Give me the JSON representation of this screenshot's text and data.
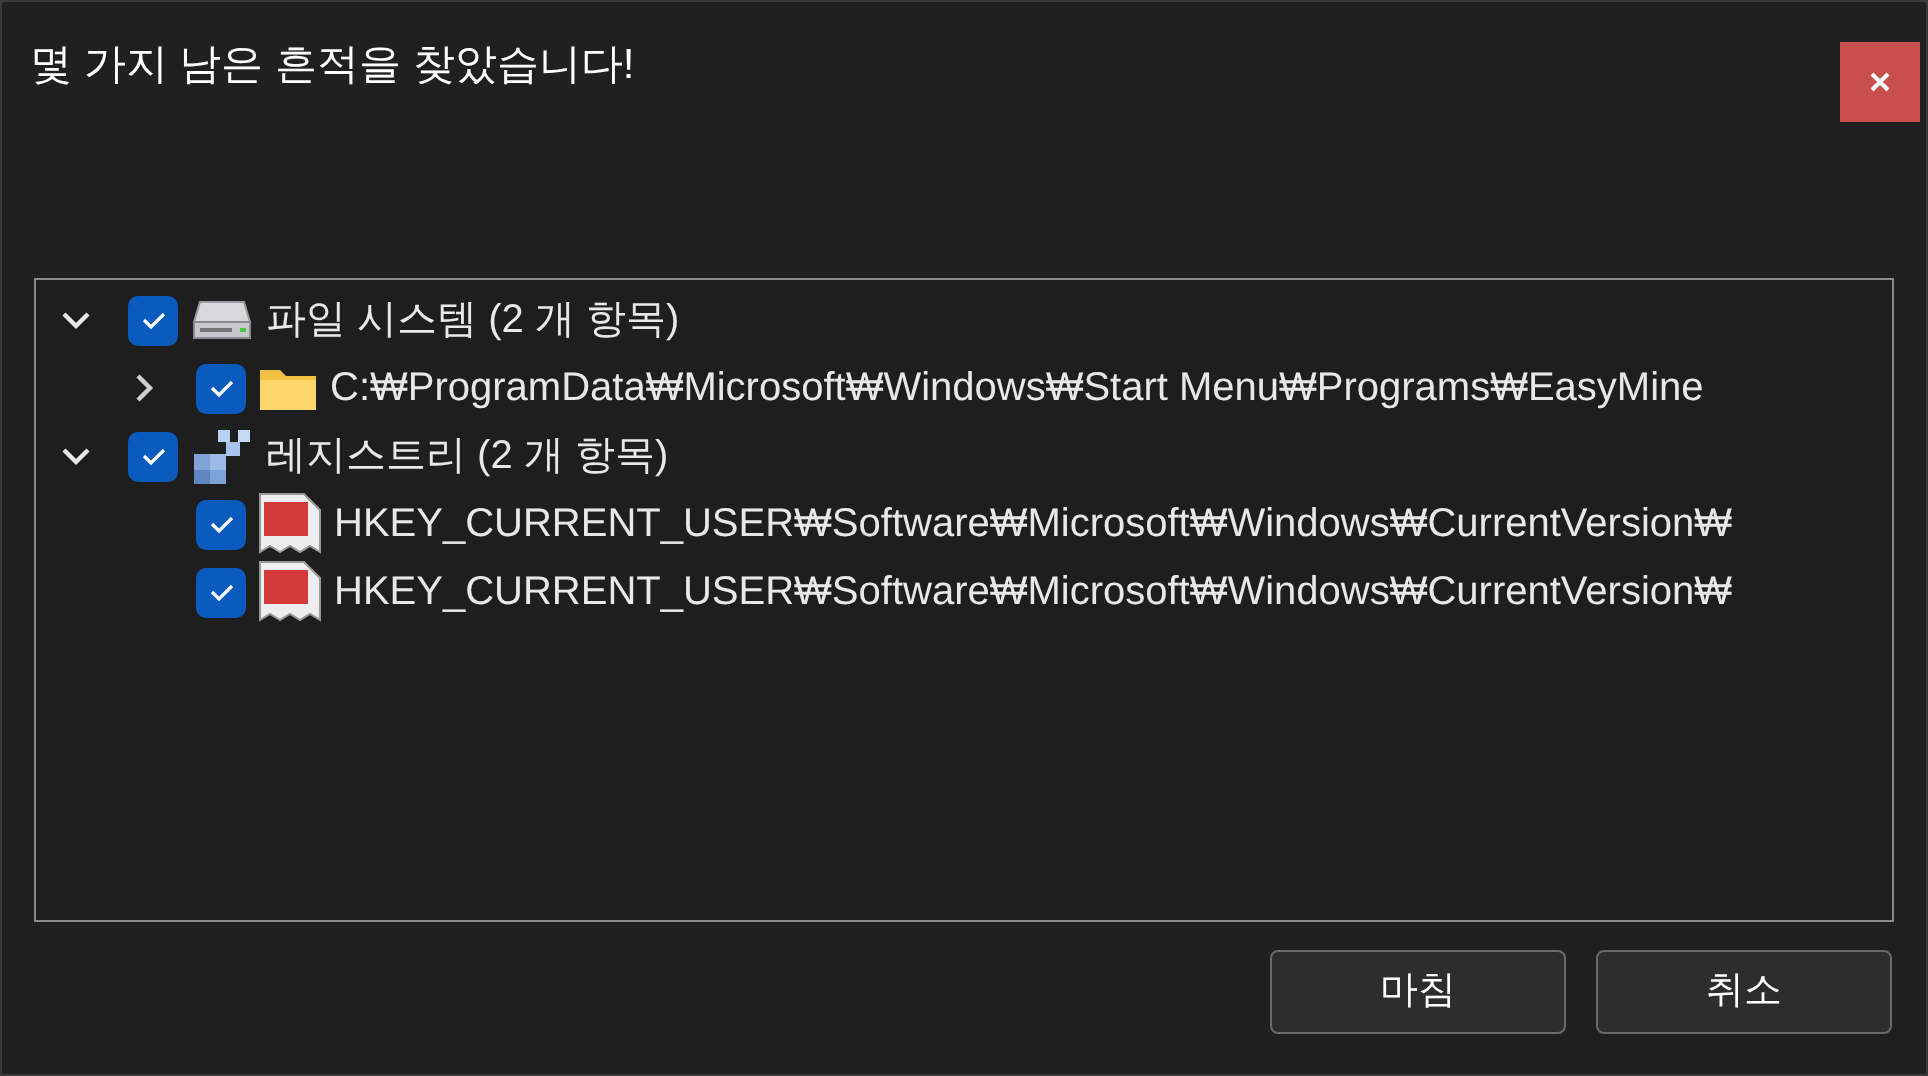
{
  "window": {
    "title": "몇 가지 남은 흔적을 찾았습니다!"
  },
  "tree": [
    {
      "kind": "drive",
      "label": "파일 시스템 (2 개 항목)",
      "checked": true,
      "expanded": true,
      "children": [
        {
          "kind": "folder",
          "label": "C:₩ProgramData₩Microsoft₩Windows₩Start Menu₩Programs₩EasyMine",
          "checked": true,
          "expanded": false
        }
      ]
    },
    {
      "kind": "registry",
      "label": "레지스트리 (2 개 항목)",
      "checked": true,
      "expanded": true,
      "children": [
        {
          "kind": "value",
          "label": "HKEY_CURRENT_USER₩Software₩Microsoft₩Windows₩CurrentVersion₩",
          "checked": true
        },
        {
          "kind": "value",
          "label": "HKEY_CURRENT_USER₩Software₩Microsoft₩Windows₩CurrentVersion₩",
          "checked": true
        }
      ]
    }
  ],
  "buttons": [
    "마침",
    "취소"
  ]
}
